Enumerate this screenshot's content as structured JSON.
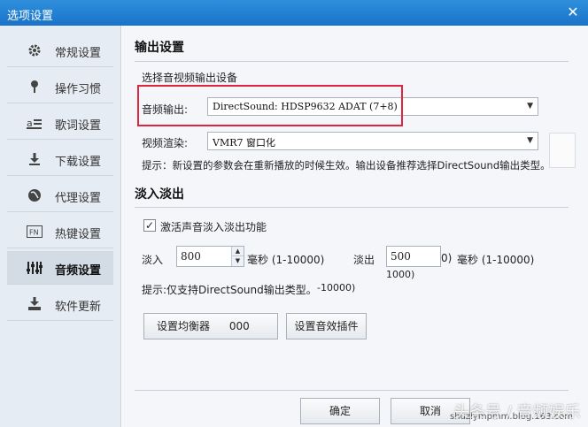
{
  "window": {
    "title": "选项设置"
  },
  "sidebar": {
    "items": [
      {
        "label": "常规设置",
        "icon": "gear-icon"
      },
      {
        "label": "操作习惯",
        "icon": "pin-icon"
      },
      {
        "label": "歌词设置",
        "icon": "lyrics-icon"
      },
      {
        "label": "下载设置",
        "icon": "download-icon"
      },
      {
        "label": "代理设置",
        "icon": "globe-icon"
      },
      {
        "label": "热键设置",
        "icon": "fn-key-icon"
      },
      {
        "label": "音频设置",
        "icon": "equalizer-icon"
      },
      {
        "label": "软件更新",
        "icon": "update-icon"
      }
    ],
    "active_index": 6
  },
  "output": {
    "section_title": "输出设置",
    "device_label": "选择音视频输出设备",
    "audio_label": "音频输出:",
    "audio_value": "DirectSound: HDSP9632 ADAT (7+8)",
    "video_label": "视频渲染:",
    "video_value": "VMR7 窗口化",
    "hint": "提示：新设置的参数会在重新播放的时候生效。输出设备推荐选择DirectSound输出类型。"
  },
  "fade": {
    "section_title": "淡入淡出",
    "enable_label": "激活声音淡入淡出功能",
    "enable_checked": true,
    "fadein_label": "淡入",
    "fadein_value": "800",
    "fadein_unit": "毫秒 (1-10000)",
    "fadeout_label": "淡出",
    "fadeout_value": "500",
    "fadeout_unit_fragment": "0)",
    "fadeout_unit": "毫秒 (1-10000)",
    "fadeout_overflow": "1000)",
    "hint": "提示:仅支持DirectSound输出类型。",
    "hint_overflow": "-10000)"
  },
  "buttons": {
    "set_output_label": "设置均衡器",
    "set_output_fragment": "000",
    "effects_label": "设置音效插件",
    "ok_label": "确定",
    "cancel_label": "取消"
  },
  "watermark": {
    "url": "shuzlympmm.blog.163.com",
    "brand": "头条号 / 音频娱乐"
  },
  "colors": {
    "accent": "#2d7fd6",
    "highlight": "#e0253f",
    "titlebar": "#1a73c9"
  }
}
